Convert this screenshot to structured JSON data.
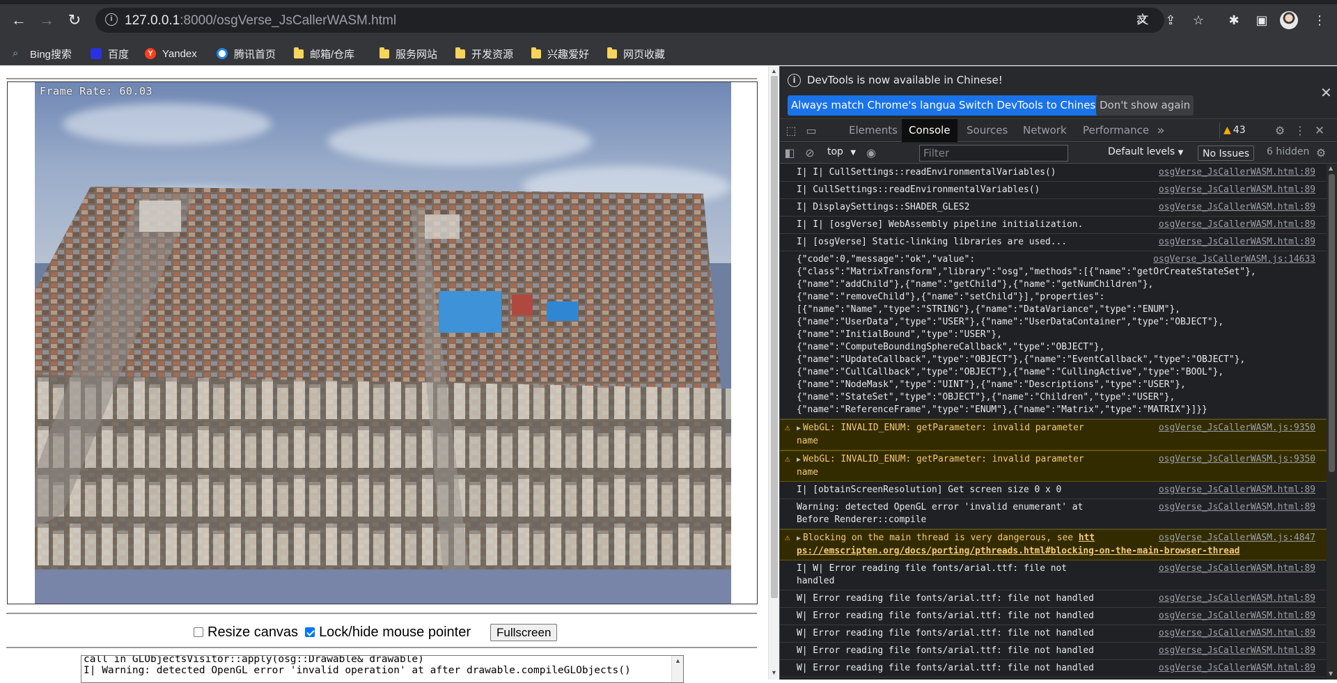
{
  "browser": {
    "url_host": "127.0.0.1",
    "url_path": ":8000/osgVerse_JsCallerWASM.html",
    "bookmarks": [
      {
        "label": "Bing搜索",
        "icon": "bing-search-icon"
      },
      {
        "label": "百度",
        "icon": "baidu-icon"
      },
      {
        "label": "Yandex",
        "icon": "yandex-icon"
      },
      {
        "label": "腾讯首页",
        "icon": "tencent-icon"
      },
      {
        "label": "邮箱/仓库",
        "icon": "folder-icon"
      },
      {
        "label": "服务网站",
        "icon": "folder-icon"
      },
      {
        "label": "开发资源",
        "icon": "folder-icon"
      },
      {
        "label": "兴趣爱好",
        "icon": "folder-icon"
      },
      {
        "label": "网页收藏",
        "icon": "folder-icon"
      }
    ]
  },
  "page": {
    "frame_rate": "Frame Rate: 60.03",
    "resize_label": "Resize canvas",
    "resize_checked": false,
    "lock_label": "Lock/hide mouse pointer",
    "lock_checked": true,
    "fullscreen_label": "Fullscreen",
    "output_lines": "call in GLObjectsVisitor::apply(osg::Drawable& drawable)\nI| Warning: detected OpenGL error 'invalid operation' at after drawable.compileGLObjects()"
  },
  "devtools": {
    "info_message": "DevTools is now available in Chinese!",
    "btn_match": "Always match Chrome's language",
    "btn_switch": "Switch DevTools to Chinese",
    "btn_dont_show": "Don't show again",
    "tabs": [
      "Elements",
      "Console",
      "Sources",
      "Network",
      "Performance"
    ],
    "active_tab": "Console",
    "warning_count": "43",
    "context": "top",
    "filter_placeholder": "Filter",
    "levels": "Default levels",
    "issues": "No Issues",
    "hidden": "6 hidden",
    "messages": [
      {
        "level": "info",
        "text": "I| I| CullSettings::readEnvironmentalVariables()",
        "source": "osgVerse_JsCallerWASM.html:89"
      },
      {
        "level": "info",
        "text": "I| CullSettings::readEnvironmentalVariables()",
        "source": "osgVerse_JsCallerWASM.html:89"
      },
      {
        "level": "info",
        "text": "I| DisplaySettings::SHADER_GLES2",
        "source": "osgVerse_JsCallerWASM.html:89"
      },
      {
        "level": "info",
        "text": "I| I| [osgVerse] WebAssembly pipeline initialization.",
        "source": "osgVerse_JsCallerWASM.html:89"
      },
      {
        "level": "info",
        "text": "I| [osgVerse] Static-linking libraries are used...",
        "source": "osgVerse_JsCallerWASM.html:89"
      },
      {
        "level": "json",
        "first": "{\"code\":0,\"message\":\"ok\",\"value\":",
        "rest": "{\"class\":\"MatrixTransform\",\"library\":\"osg\",\"methods\":[{\"name\":\"getOrCreateStateSet\"},\n{\"name\":\"addChild\"},{\"name\":\"getChild\"},{\"name\":\"getNumChildren\"},\n{\"name\":\"removeChild\"},{\"name\":\"setChild\"}],\"properties\":\n[{\"name\":\"Name\",\"type\":\"STRING\"},{\"name\":\"DataVariance\",\"type\":\"ENUM\"},\n{\"name\":\"UserData\",\"type\":\"USER\"},{\"name\":\"UserDataContainer\",\"type\":\"OBJECT\"},\n{\"name\":\"InitialBound\",\"type\":\"USER\"},\n{\"name\":\"ComputeBoundingSphereCallback\",\"type\":\"OBJECT\"},\n{\"name\":\"UpdateCallback\",\"type\":\"OBJECT\"},{\"name\":\"EventCallback\",\"type\":\"OBJECT\"},\n{\"name\":\"CullCallback\",\"type\":\"OBJECT\"},{\"name\":\"CullingActive\",\"type\":\"BOOL\"},\n{\"name\":\"NodeMask\",\"type\":\"UINT\"},{\"name\":\"Descriptions\",\"type\":\"USER\"},\n{\"name\":\"StateSet\",\"type\":\"OBJECT\"},{\"name\":\"Children\",\"type\":\"USER\"},\n{\"name\":\"ReferenceFrame\",\"type\":\"ENUM\"},{\"name\":\"Matrix\",\"type\":\"MATRIX\"}]}}",
        "source": "osgVerse_JsCallerWASM.js:14633"
      },
      {
        "level": "warn",
        "text": "WebGL: INVALID_ENUM: getParameter: invalid parameter\nname",
        "source": "osgVerse_JsCallerWASM.js:9350"
      },
      {
        "level": "warn",
        "text": "WebGL: INVALID_ENUM: getParameter: invalid parameter\nname",
        "source": "osgVerse_JsCallerWASM.js:9350"
      },
      {
        "level": "info",
        "text": "I| [obtainScreenResolution] Get screen size 0 x 0",
        "source": "osgVerse_JsCallerWASM.html:89"
      },
      {
        "level": "info",
        "text": "Warning: detected OpenGL error 'invalid enumerant' at\nBefore Renderer::compile",
        "source": "osgVerse_JsCallerWASM.html:89"
      },
      {
        "level": "warnlink",
        "text": "Blocking on the main thread is very dangerous, see ",
        "link1": "htt",
        "link2": "ps://emscripten.org/docs/porting/pthreads.html#blocking-on-the-main-browser-thread",
        "source": "osgVerse_JsCallerWASM.js:4847"
      },
      {
        "level": "info",
        "text": "I| W| Error reading file fonts/arial.ttf: file not\nhandled",
        "source": "osgVerse_JsCallerWASM.html:89"
      },
      {
        "level": "info",
        "text": "W| Error reading file fonts/arial.ttf: file not handled",
        "source": "osgVerse_JsCallerWASM.html:89"
      },
      {
        "level": "info",
        "text": "W| Error reading file fonts/arial.ttf: file not handled",
        "source": "osgVerse_JsCallerWASM.html:89"
      },
      {
        "level": "info",
        "text": "W| Error reading file fonts/arial.ttf: file not handled",
        "source": "osgVerse_JsCallerWASM.html:89"
      },
      {
        "level": "info",
        "text": "W| Error reading file fonts/arial.ttf: file not handled",
        "source": "osgVerse_JsCallerWASM.html:89"
      },
      {
        "level": "info",
        "text": "W| Error reading file fonts/arial.ttf: file not handled",
        "source": "osgVerse_JsCallerWASM.html:89"
      }
    ]
  }
}
